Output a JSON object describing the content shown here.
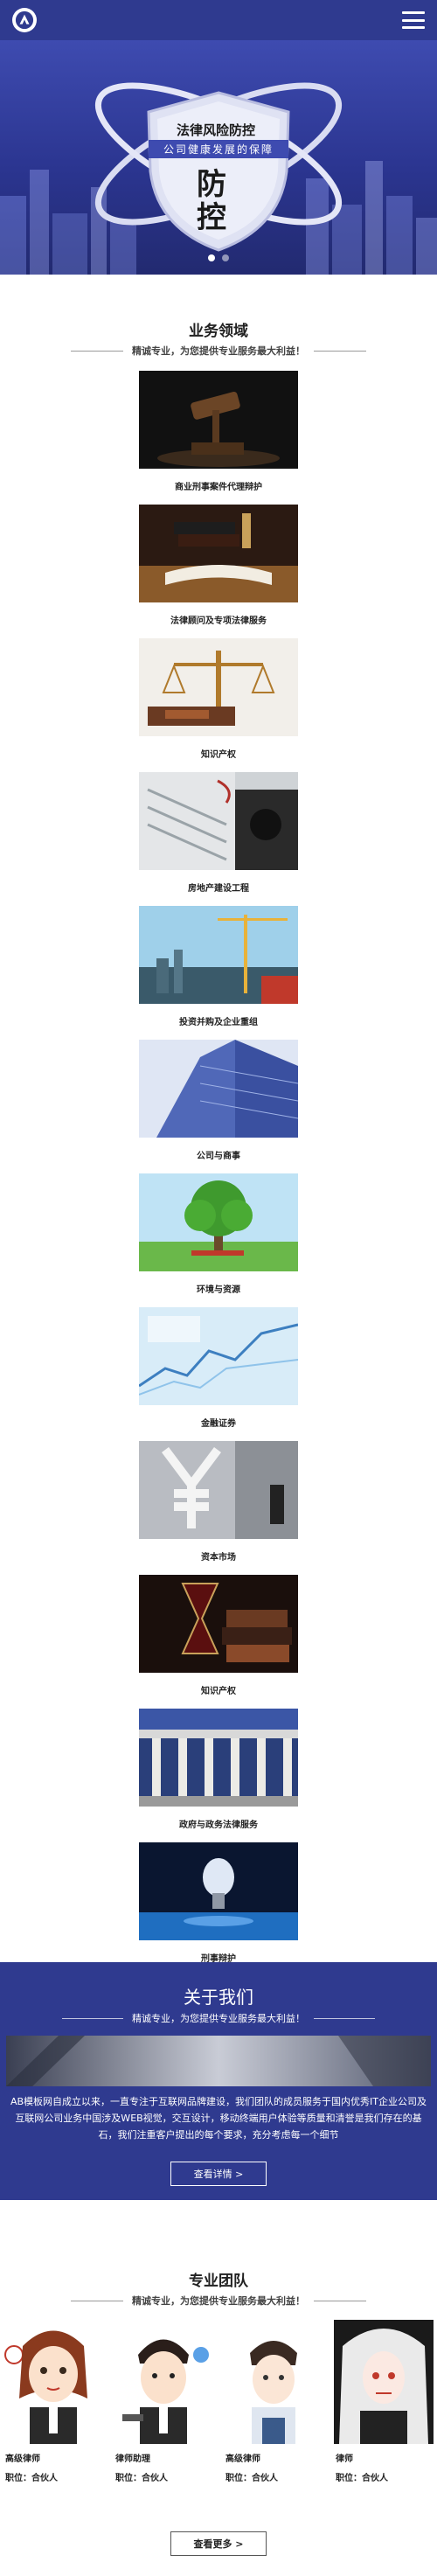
{
  "header": {
    "logo_icon": "logo-a-icon",
    "menu_icon": "hamburger-menu-icon"
  },
  "banner": {
    "title": "法律风险防控",
    "subtitle": "公司健康发展的保障",
    "big_text": "防控",
    "slides": 2,
    "active_slide": 1
  },
  "business": {
    "title": "业务领域",
    "subtitle": "精诚专业，为您提供专业服务最大利益！",
    "items": [
      {
        "label": "商业刑事案件代理辩护"
      },
      {
        "label": "法律顾问及专项法律服务"
      },
      {
        "label": "知识产权"
      },
      {
        "label": "房地产建设工程"
      },
      {
        "label": "投资并购及企业重组"
      },
      {
        "label": "公司与商事"
      },
      {
        "label": "环境与资源"
      },
      {
        "label": "金融证券"
      },
      {
        "label": "资本市场"
      },
      {
        "label": "知识产权"
      },
      {
        "label": "政府与政务法律服务"
      },
      {
        "label": "刑事辩护"
      }
    ]
  },
  "about": {
    "title": "关于我们",
    "subtitle": "精诚专业，为您提供专业服务最大利益！",
    "text": "AB模板网自成立以来，一直专注于互联网品牌建设，我们团队的成员服务于国内优秀IT企业公司及互联网公司业务中国涉及WEB视觉，交互设计，移动终端用户体验等质量和清誉是我们存在的基石，我们注重客户提出的每个要求，充分考虑每一个细节",
    "button": "查看详情 >"
  },
  "team": {
    "title": "专业团队",
    "subtitle": "精诚专业，为您提供专业服务最大利益！",
    "members": [
      {
        "name": "高级律师",
        "role": "职位：合伙人"
      },
      {
        "name": "律师助理",
        "role": "职位：合伙人"
      },
      {
        "name": "高级律师",
        "role": "职位：合伙人"
      },
      {
        "name": "律师",
        "role": "职位：合伙人"
      }
    ],
    "more_button": "查看更多 >"
  }
}
